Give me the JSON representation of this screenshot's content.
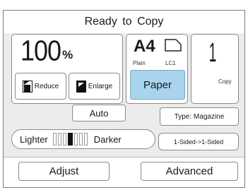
{
  "status": {
    "title": "Ready to Copy"
  },
  "zoom": {
    "value": "100",
    "unit": "%"
  },
  "reduce": {
    "label": "Reduce",
    "icon": "reduce-icon"
  },
  "enlarge": {
    "label": "Enlarge",
    "icon": "enlarge-icon"
  },
  "paper": {
    "size": "A4",
    "type": "Plain",
    "tray": "LC1",
    "tray_icon": "paper-tray-icon",
    "button_label": "Paper"
  },
  "copies": {
    "count": "1",
    "label": "Copy"
  },
  "auto": {
    "label": "Auto"
  },
  "type": {
    "label": "Type: Magazine"
  },
  "density": {
    "lighter_label": "Lighter",
    "darker_label": "Darker",
    "level": 4,
    "max": 7
  },
  "sided": {
    "label": "1-Sided->1-Sided"
  },
  "bottom": {
    "adjust_label": "Adjust",
    "advanced_label": "Advanced"
  },
  "colors": {
    "accent": "#aad4ee",
    "panel": "#ececec",
    "border": "#8a8a8a"
  }
}
